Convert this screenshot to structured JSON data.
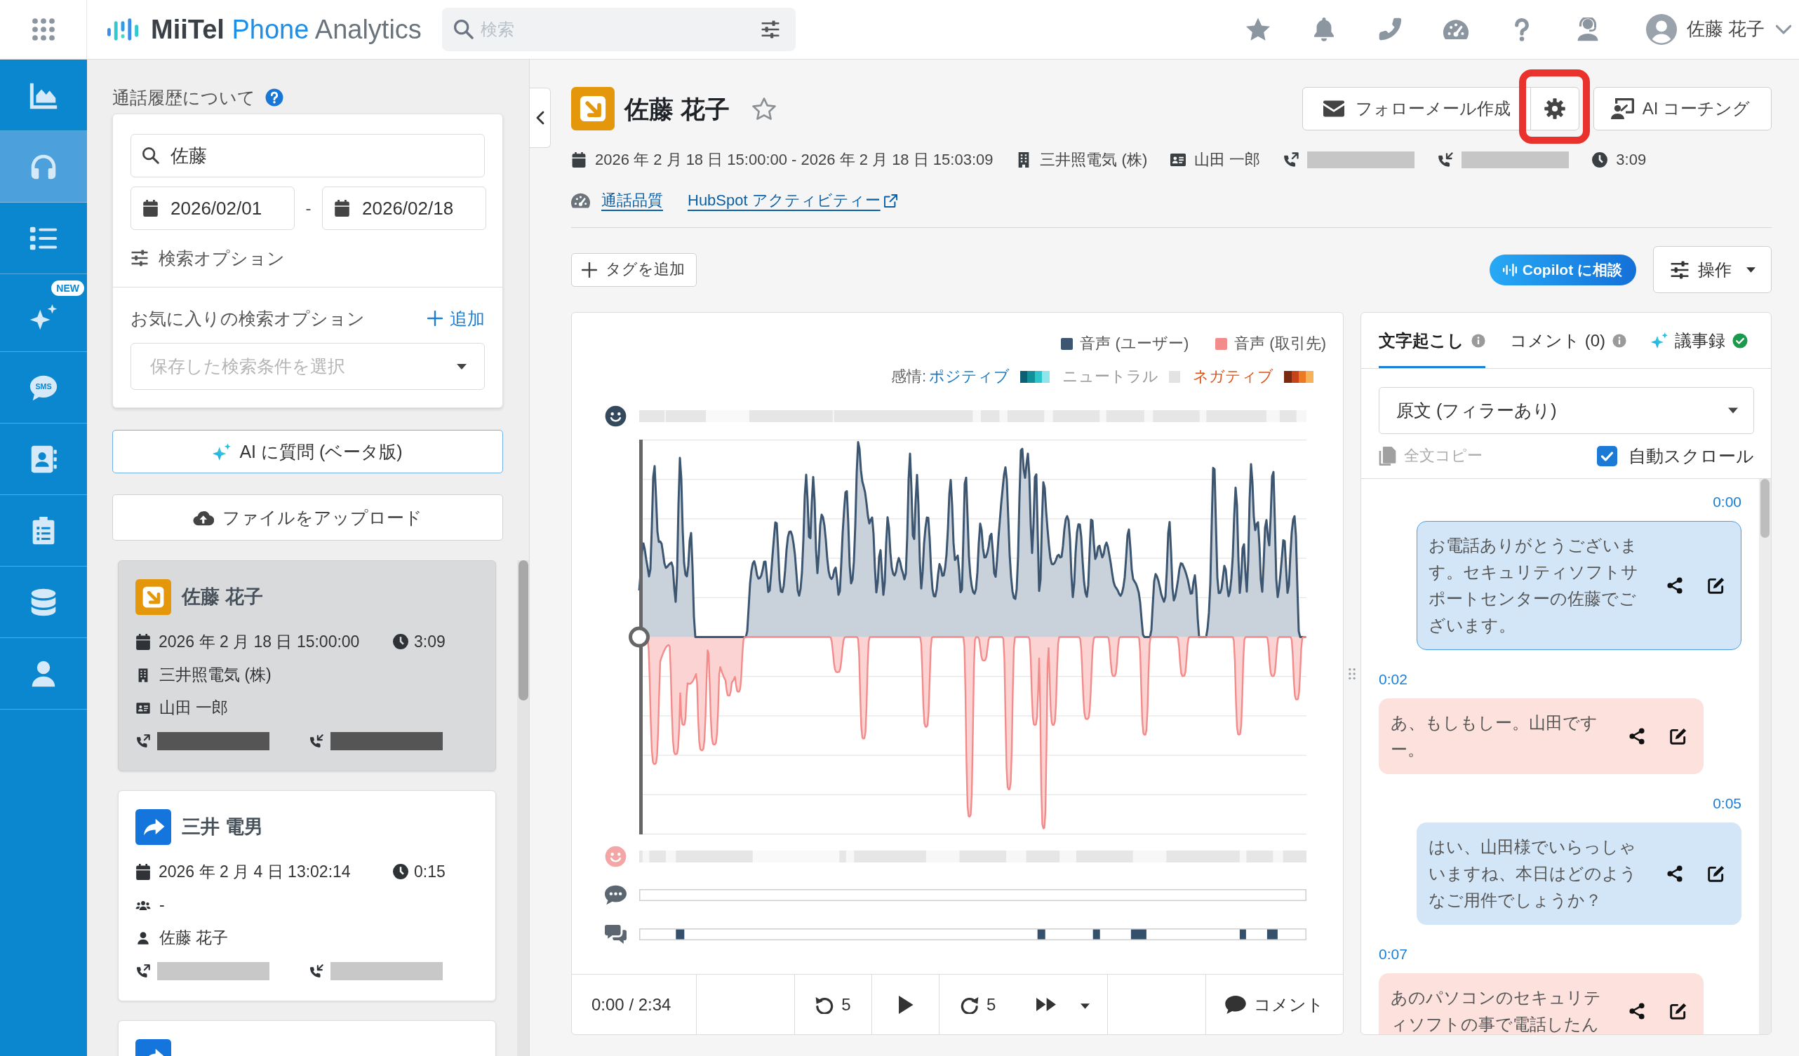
{
  "top_bar": {
    "logo": {
      "brand": "MiiTel",
      "product": "Phone",
      "suffix": "Analytics"
    },
    "search": {
      "placeholder": "検索"
    },
    "user": {
      "name": "佐藤 花子"
    }
  },
  "sidebar": {
    "items": [
      {
        "kind": "analytics",
        "selected": false
      },
      {
        "kind": "calls",
        "selected": true
      },
      {
        "kind": "list",
        "selected": false
      },
      {
        "kind": "ai",
        "selected": false,
        "badge": "NEW"
      },
      {
        "kind": "sms",
        "selected": false,
        "label": "SMS"
      },
      {
        "kind": "contacts",
        "selected": false
      },
      {
        "kind": "tasks",
        "selected": false
      },
      {
        "kind": "data",
        "selected": false
      },
      {
        "kind": "users",
        "selected": false
      }
    ]
  },
  "history_panel": {
    "title": "通話履歴について",
    "search": {
      "value": "佐藤"
    },
    "date_from": "2026/02/01",
    "date_separator": "-",
    "date_to": "2026/02/18",
    "options_label": "検索オプション",
    "favorites": {
      "label": "お気に入りの検索オプション",
      "add_label": "追加",
      "placeholder": "保存した検索条件を選択"
    },
    "ask_ai_button": "AI に質問 (ベータ版)",
    "upload_button": "ファイルをアップロード",
    "calls": [
      {
        "kind": "incoming",
        "name": "佐藤 花子",
        "selected": true,
        "datetime": "2026 年 2 月 18 日 15:00:00",
        "duration": "3:09",
        "details": [
          {
            "kind": "company",
            "text": "三井照電気 (株)"
          },
          {
            "kind": "contact",
            "text": "山田 一郎"
          }
        ],
        "phones": [
          {
            "kind": "caller",
            "redacted": true
          },
          {
            "kind": "callee",
            "redacted": true
          }
        ]
      },
      {
        "kind": "outgoing",
        "name": "三井 電男",
        "selected": false,
        "datetime": "2026 年 2 月 4 日 13:02:14",
        "duration": "0:15",
        "details": [
          {
            "kind": "group",
            "text": "-"
          },
          {
            "kind": "user",
            "text": "佐藤 花子"
          }
        ],
        "phones": [
          {
            "kind": "caller",
            "redacted": true
          },
          {
            "kind": "callee",
            "redacted": true
          }
        ]
      },
      {
        "kind": "outgoing",
        "selected": false
      }
    ]
  },
  "call_header": {
    "kind": "incoming",
    "name": "佐藤 花子",
    "favorite": false,
    "actions": [
      {
        "kind": "mail",
        "label": "フォローメール作成"
      },
      {
        "kind": "settings",
        "highlighted": true
      },
      {
        "kind": "coaching",
        "label": "AI コーチング"
      }
    ],
    "meta": [
      {
        "kind": "datetime",
        "text": "2026 年 2 月 18 日 15:00:00 - 2026 年 2 月 18 日 15:03:09"
      },
      {
        "kind": "company",
        "text": "三井照電気 (株)"
      },
      {
        "kind": "contact",
        "text": "山田 一郎"
      },
      {
        "kind": "caller",
        "redacted": true
      },
      {
        "kind": "callee",
        "redacted": true
      },
      {
        "kind": "duration",
        "text": "3:09"
      }
    ],
    "links": [
      {
        "kind": "quality",
        "label": "通話品質"
      },
      {
        "kind": "activity",
        "label": "HubSpot アクティビティー"
      }
    ],
    "add_tag_button": "タグを追加",
    "copilot_button": "Copilot に相談",
    "operations_button": "操作"
  },
  "player": {
    "legend": [
      {
        "label": "音声 (ユーザー)",
        "color": "#3c5570"
      },
      {
        "label": "音声 (取引先)",
        "color": "#f48b8b"
      }
    ],
    "sentiment": {
      "label": "感情:",
      "levels": [
        {
          "kind": "positive",
          "label": "ポジティブ",
          "color": "#1679c4"
        },
        {
          "kind": "neutral",
          "label": "ニュートラル",
          "color": "#9a9a9a"
        },
        {
          "kind": "negative",
          "label": "ネガティブ",
          "color": "#dd5418"
        }
      ]
    },
    "playhead": {
      "level": 0
    },
    "time": "0:00 / 2:34",
    "skip_back": "5",
    "skip_forward": "5",
    "playing": false,
    "comment_button": "コメント"
  },
  "transcript_panel": {
    "tabs": [
      {
        "kind": "info",
        "label": "文字起こし",
        "selected": true
      },
      {
        "kind": "info",
        "label": "コメント (0)",
        "selected": false
      },
      {
        "kind": "ai_done",
        "label": "議事録",
        "selected": false
      }
    ],
    "mode_select": "原文 (フィラーあり)",
    "copy_all": {
      "label": "全文コピー",
      "disabled": true
    },
    "auto_scroll": {
      "label": "自動スクロール",
      "checked": true
    },
    "messages": [
      {
        "kind": "user",
        "time": "0:00",
        "text": "お電話ありがとうございます。セキュリティソフトサポートセンターの佐藤でございます。",
        "current": true
      },
      {
        "kind": "customer",
        "time": "0:02",
        "text": "あ、もしもしー。山田ですー。",
        "current": false
      },
      {
        "kind": "user",
        "time": "0:05",
        "text": "はい、山田様でいらっしゃいますね、本日はどのようなご用件でしょうか？",
        "current": false
      },
      {
        "kind": "customer",
        "time": "0:07",
        "text": "あのパソコンのセキュリティソフトの事で電話したん",
        "current": false
      }
    ]
  }
}
